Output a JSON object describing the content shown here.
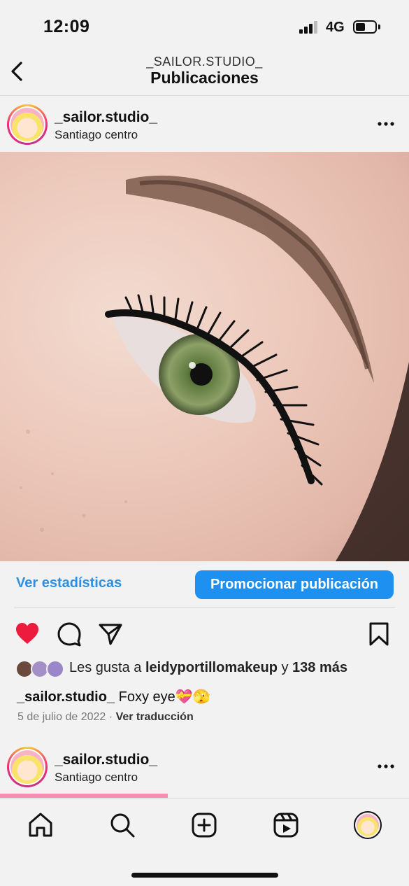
{
  "status_bar": {
    "time": "12:09",
    "network": "4G"
  },
  "header": {
    "subtitle": "_SAILOR.STUDIO_",
    "title": "Publicaciones"
  },
  "post": {
    "username": "_sailor.studio_",
    "location": "Santiago centro",
    "stats_link": "Ver estadísticas",
    "promote_label": "Promocionar publicación",
    "likes_prefix": "Les gusta a",
    "likes_user": "leidyportillomakeup",
    "likes_conj": "y",
    "likes_count": "138 más",
    "caption_user": "_sailor.studio_",
    "caption_text": "Foxy eye💝🫣",
    "date": "5 de julio de 2022",
    "separator": "·",
    "translate_label": "Ver traducción"
  },
  "next_post": {
    "username": "_sailor.studio_",
    "location": "Santiago centro"
  },
  "icons": {
    "back": "chevron-left-icon",
    "more": "more-horizontal-icon",
    "like": "heart-filled-icon",
    "comment": "comment-icon",
    "share": "send-icon",
    "save": "bookmark-icon",
    "home": "home-icon",
    "search": "search-icon",
    "create": "plus-square-icon",
    "reels": "reels-icon",
    "profile": "profile-avatar"
  },
  "colors": {
    "accent": "#1e90f0",
    "link": "#2f8fe0",
    "like": "#ed1c3f",
    "pink": "#f48fb1"
  }
}
